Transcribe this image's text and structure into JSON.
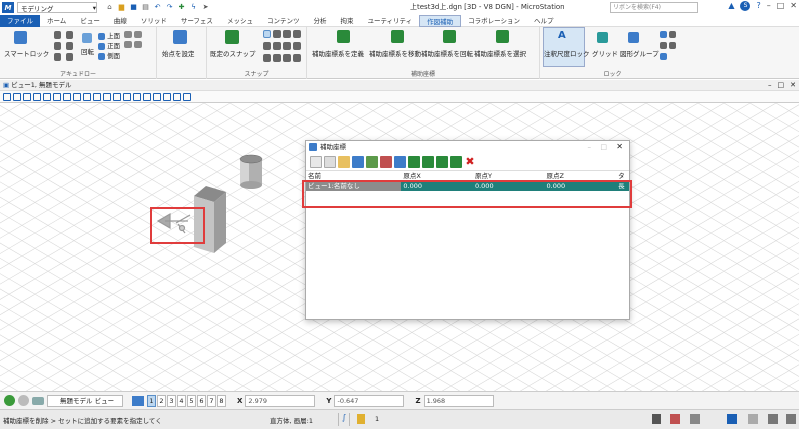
{
  "titlebar": {
    "workspace": "モデリング",
    "document_title": "上test3d上.dgn [3D - V8 DGN] - MicroStation",
    "search_placeholder": "リボンを検索(F4)",
    "user_initial": "S"
  },
  "tabs": [
    "ファイル",
    "ホーム",
    "ビュー",
    "曲線",
    "ソリッド",
    "サーフェス",
    "メッシュ",
    "コンテンツ",
    "分析",
    "拘束",
    "ユーティリティ",
    "作図補助",
    "コラボレーション",
    "ヘルプ"
  ],
  "active_tab_index": 11,
  "ribbon": {
    "accudraw": {
      "label": "アキュドロー",
      "smart_lock": "スマートロック",
      "rotate": "回転",
      "top": "上面",
      "front": "正面",
      "side": "側面"
    },
    "set_origin": "始点を設定",
    "snaps": {
      "label": "スナップ",
      "default_snap": "既定のスナップ"
    },
    "acs": {
      "label": "補助座標",
      "define": "補助座標系を定義",
      "move": "補助座標系を移動",
      "rotate": "補助座標系を回転",
      "select": "補助座標系を選択"
    },
    "locks": {
      "label": "ロック",
      "annotation_scale": "注釈尺度ロック",
      "grid": "グリッド",
      "graphic_group": "図形グループ"
    }
  },
  "view": {
    "title": "ビュー1, 無題モデル"
  },
  "dialog": {
    "title": "補助座標",
    "columns": [
      "名前",
      "原点X",
      "原点Y",
      "原点Z",
      "タ"
    ],
    "row": [
      "ビュー1:名前なし",
      "0.000",
      "0.000",
      "0.000",
      "長"
    ]
  },
  "bottombar": {
    "view_model": "無題モデル ビュー",
    "view_numbers": [
      "1",
      "2",
      "3",
      "4",
      "5",
      "6",
      "7",
      "8"
    ],
    "x_label": "X",
    "x_value": "2.979",
    "y_label": "Y",
    "y_value": "-0.647",
    "z_label": "Z",
    "z_value": "1.968"
  },
  "statusbar": {
    "prompt": "補助座標を削除 > セットに追加する要素を指定してく",
    "info": "直方体, 画層:1",
    "level": "1"
  },
  "colors": {
    "accent": "#1a5fb4",
    "selection_row": "#1f7f7a",
    "highlight": "#e03c3c"
  }
}
